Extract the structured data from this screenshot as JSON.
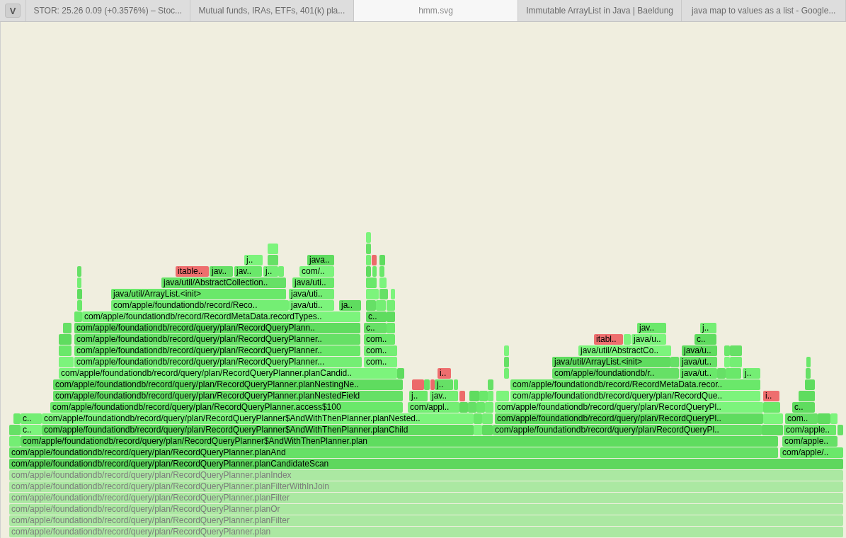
{
  "browser": {
    "app_letter": "V",
    "tabs": [
      {
        "label": "STOR: 25.26 0.09 (+0.3576%) – Stoc...",
        "selected": false
      },
      {
        "label": "Mutual funds, IRAs, ETFs, 401(k) pla...",
        "selected": false
      },
      {
        "label": "hmm.svg",
        "selected": true
      },
      {
        "label": "Immutable ArrayList in Java | Baeldung",
        "selected": false
      },
      {
        "label": "java map to values as a list - Google...",
        "selected": false
      }
    ]
  },
  "flame_graph": {
    "rows": [
      {
        "frames": [
          {
            "label": "j..",
            "kind": "java"
          },
          {
            "label": "java..",
            "kind": "java"
          }
        ]
      },
      {
        "frames": [
          {
            "label": "itable..",
            "kind": "native"
          },
          {
            "label": "jav..",
            "kind": "java"
          },
          {
            "label": "jav..",
            "kind": "java"
          },
          {
            "label": "j..",
            "kind": "java"
          },
          {
            "label": "com/..",
            "kind": "java"
          }
        ]
      },
      {
        "frames": [
          {
            "label": "java/util/AbstractCollection..",
            "kind": "java"
          },
          {
            "label": "java/uti..",
            "kind": "java"
          }
        ]
      },
      {
        "frames": [
          {
            "label": "java/util/ArrayList.<init>",
            "kind": "java"
          },
          {
            "label": "java/uti..",
            "kind": "java"
          }
        ]
      },
      {
        "frames": [
          {
            "label": "com/apple/foundationdb/record/Reco..",
            "kind": "java"
          },
          {
            "label": "java/uti..",
            "kind": "java"
          },
          {
            "label": "ja..",
            "kind": "java"
          }
        ]
      },
      {
        "frames": [
          {
            "label": "com/apple/foundationdb/record/RecordMetaData.recordTypes..",
            "kind": "java"
          },
          {
            "label": "c..",
            "kind": "java"
          }
        ]
      },
      {
        "frames": [
          {
            "label": "com/apple/foundationdb/record/query/plan/RecordQueryPlann..",
            "kind": "java"
          },
          {
            "label": "c..",
            "kind": "java"
          },
          {
            "label": "jav..",
            "kind": "java"
          },
          {
            "label": "j..",
            "kind": "java"
          }
        ]
      },
      {
        "frames": [
          {
            "label": "com/apple/foundationdb/record/query/plan/RecordQueryPlanner..",
            "kind": "java"
          },
          {
            "label": "com..",
            "kind": "java"
          },
          {
            "label": "itabl..",
            "kind": "native"
          },
          {
            "label": "java/u..",
            "kind": "java"
          },
          {
            "label": "c..",
            "kind": "java"
          }
        ]
      },
      {
        "frames": [
          {
            "label": "com/apple/foundationdb/record/query/plan/RecordQueryPlanner..",
            "kind": "java"
          },
          {
            "label": "com..",
            "kind": "java"
          },
          {
            "label": "java/util/AbstractCo..",
            "kind": "java"
          },
          {
            "label": "java/u..",
            "kind": "java"
          }
        ]
      },
      {
        "frames": [
          {
            "label": "com/apple/foundationdb/record/query/plan/RecordQueryPlanner...",
            "kind": "java"
          },
          {
            "label": "com..",
            "kind": "java"
          },
          {
            "label": "java/util/ArrayList.<init>",
            "kind": "java"
          },
          {
            "label": "java/ut..",
            "kind": "java"
          }
        ]
      },
      {
        "frames": [
          {
            "label": "com/apple/foundationdb/record/query/plan/RecordQueryPlanner.planCandid..",
            "kind": "java"
          },
          {
            "label": "i..",
            "kind": "native"
          },
          {
            "label": "com/apple/foundationdb/r..",
            "kind": "java"
          },
          {
            "label": "java/ut..",
            "kind": "java"
          },
          {
            "label": "j..",
            "kind": "java"
          }
        ]
      },
      {
        "frames": [
          {
            "label": "com/apple/foundationdb/record/query/plan/RecordQueryPlanner.planNestingNe..",
            "kind": "java"
          },
          {
            "label": "j..",
            "kind": "java"
          },
          {
            "label": "com/apple/foundationdb/record/RecordMetaData.recor..",
            "kind": "java"
          }
        ]
      },
      {
        "frames": [
          {
            "label": "com/apple/foundationdb/record/query/plan/RecordQueryPlanner.planNestedField",
            "kind": "java"
          },
          {
            "label": "j..",
            "kind": "java"
          },
          {
            "label": "jav..",
            "kind": "java"
          },
          {
            "label": "com/apple/foundationdb/record/query/plan/RecordQue..",
            "kind": "java"
          },
          {
            "label": "i..",
            "kind": "native"
          }
        ]
      },
      {
        "frames": [
          {
            "label": "com/apple/foundationdb/record/query/plan/RecordQueryPlanner.access$100",
            "kind": "java"
          },
          {
            "label": "com/appl..",
            "kind": "java"
          },
          {
            "label": "com/apple/foundationdb/record/query/plan/RecordQueryPl..",
            "kind": "java"
          },
          {
            "label": "c..",
            "kind": "java"
          }
        ]
      },
      {
        "frames": [
          {
            "label": "c..",
            "kind": "java"
          },
          {
            "label": "com/apple/foundationdb/record/query/plan/RecordQueryPlanner$AndWithThenPlanner.planNested..",
            "kind": "java"
          },
          {
            "label": "com/apple/foundationdb/record/query/plan/RecordQueryPl..",
            "kind": "java"
          },
          {
            "label": "com..",
            "kind": "java"
          }
        ]
      },
      {
        "frames": [
          {
            "label": "c..",
            "kind": "java"
          },
          {
            "label": "com/apple/foundationdb/record/query/plan/RecordQueryPlanner$AndWithThenPlanner.planChild",
            "kind": "java"
          },
          {
            "label": "com/apple/foundationdb/record/query/plan/RecordQueryPl..",
            "kind": "java"
          },
          {
            "label": "com/apple..",
            "kind": "java"
          }
        ]
      },
      {
        "frames": [
          {
            "label": "com/apple/foundationdb/record/query/plan/RecordQueryPlanner$AndWithThenPlanner.plan",
            "kind": "java"
          },
          {
            "label": "com/apple..",
            "kind": "java"
          }
        ]
      },
      {
        "frames": [
          {
            "label": "com/apple/foundationdb/record/query/plan/RecordQueryPlanner.planAnd",
            "kind": "java"
          },
          {
            "label": "com/apple/..",
            "kind": "java"
          }
        ]
      },
      {
        "frames": [
          {
            "label": "com/apple/foundationdb/record/query/plan/RecordQueryPlanner.planCandidateScan",
            "kind": "java"
          }
        ]
      },
      {
        "frames": [
          {
            "label": "com/apple/foundationdb/record/query/plan/RecordQueryPlanner.planIndex",
            "kind": "faded"
          }
        ]
      },
      {
        "frames": [
          {
            "label": "com/apple/foundationdb/record/query/plan/RecordQueryPlanner.planFilterWithInJoin",
            "kind": "faded"
          }
        ]
      },
      {
        "frames": [
          {
            "label": "com/apple/foundationdb/record/query/plan/RecordQueryPlanner.planFilter",
            "kind": "faded"
          }
        ]
      },
      {
        "frames": [
          {
            "label": "com/apple/foundationdb/record/query/plan/RecordQueryPlanner.planOr",
            "kind": "faded"
          }
        ]
      },
      {
        "frames": [
          {
            "label": "com/apple/foundationdb/record/query/plan/RecordQueryPlanner.planFilter",
            "kind": "faded"
          }
        ]
      },
      {
        "frames": [
          {
            "label": "com/apple/foundationdb/record/query/plan/RecordQueryPlanner.plan",
            "kind": "faded"
          }
        ]
      }
    ]
  }
}
